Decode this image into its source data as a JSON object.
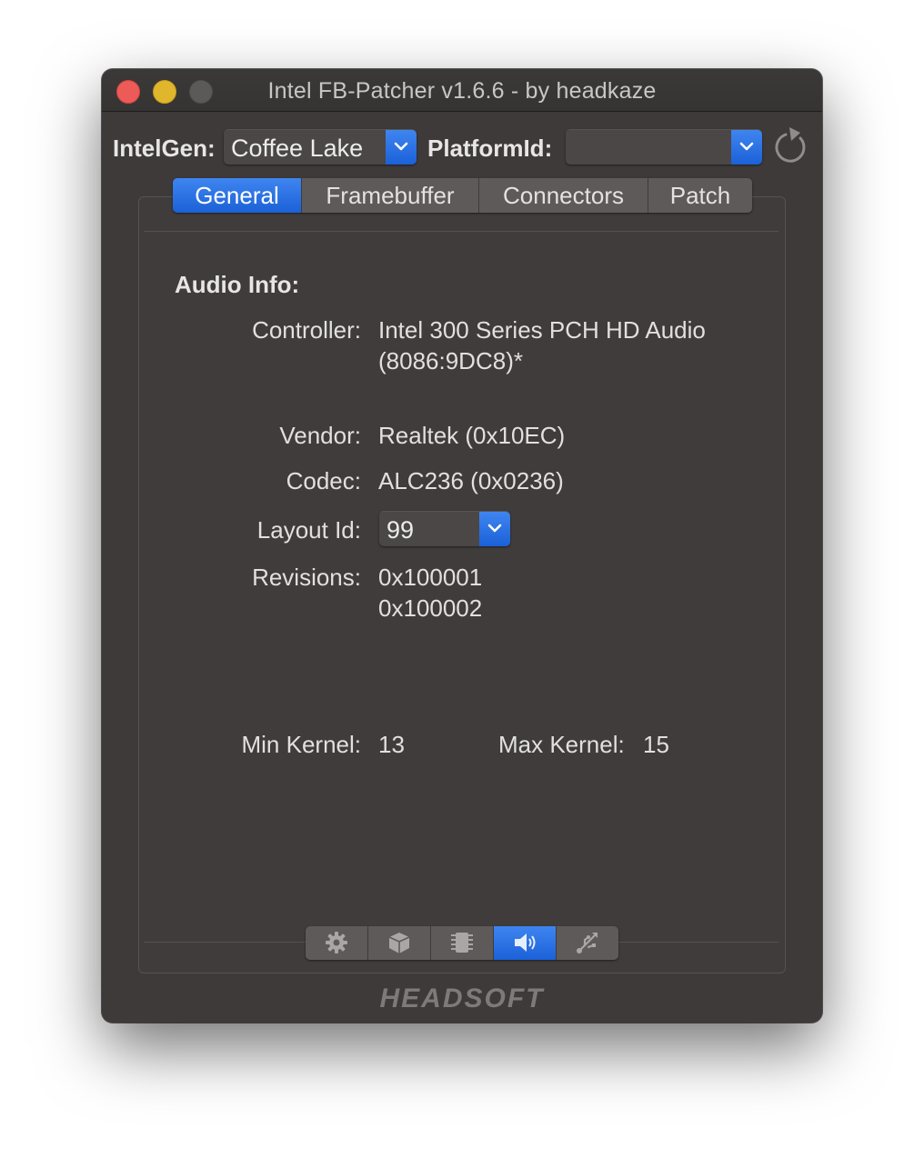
{
  "window": {
    "title": "Intel FB-Patcher v1.6.6 - by headkaze"
  },
  "toolbar": {
    "intelgen_label": "IntelGen:",
    "intelgen_value": "Coffee Lake",
    "platformid_label": "PlatformId:",
    "platformid_value": "",
    "refresh_icon": "refresh-icon"
  },
  "tabs": [
    {
      "label": "General",
      "active": true
    },
    {
      "label": "Framebuffer",
      "active": false
    },
    {
      "label": "Connectors",
      "active": false
    },
    {
      "label": "Patch",
      "active": false
    }
  ],
  "audio": {
    "heading": "Audio Info:",
    "controller_label": "Controller:",
    "controller_line1": "Intel 300 Series PCH HD Audio",
    "controller_line2": "(8086:9DC8)*",
    "vendor_label": "Vendor:",
    "vendor_value": "Realtek (0x10EC)",
    "codec_label": "Codec:",
    "codec_value": "ALC236 (0x0236)",
    "layout_label": "Layout Id:",
    "layout_value": "99",
    "revisions_label": "Revisions:",
    "revisions": [
      "0x100001",
      "0x100002"
    ],
    "min_kernel_label": "Min Kernel:",
    "min_kernel_value": "13",
    "max_kernel_label": "Max Kernel:",
    "max_kernel_value": "15"
  },
  "iconbar": [
    {
      "icon": "gear-icon",
      "active": false
    },
    {
      "icon": "box-icon",
      "active": false
    },
    {
      "icon": "chip-icon",
      "active": false
    },
    {
      "icon": "speaker-icon",
      "active": true
    },
    {
      "icon": "usb-icon",
      "active": false
    }
  ],
  "brand": {
    "logo_text": "HEADSOFT"
  },
  "colors": {
    "accent": "#2f74ec",
    "window_bg": "#3d3a39"
  }
}
